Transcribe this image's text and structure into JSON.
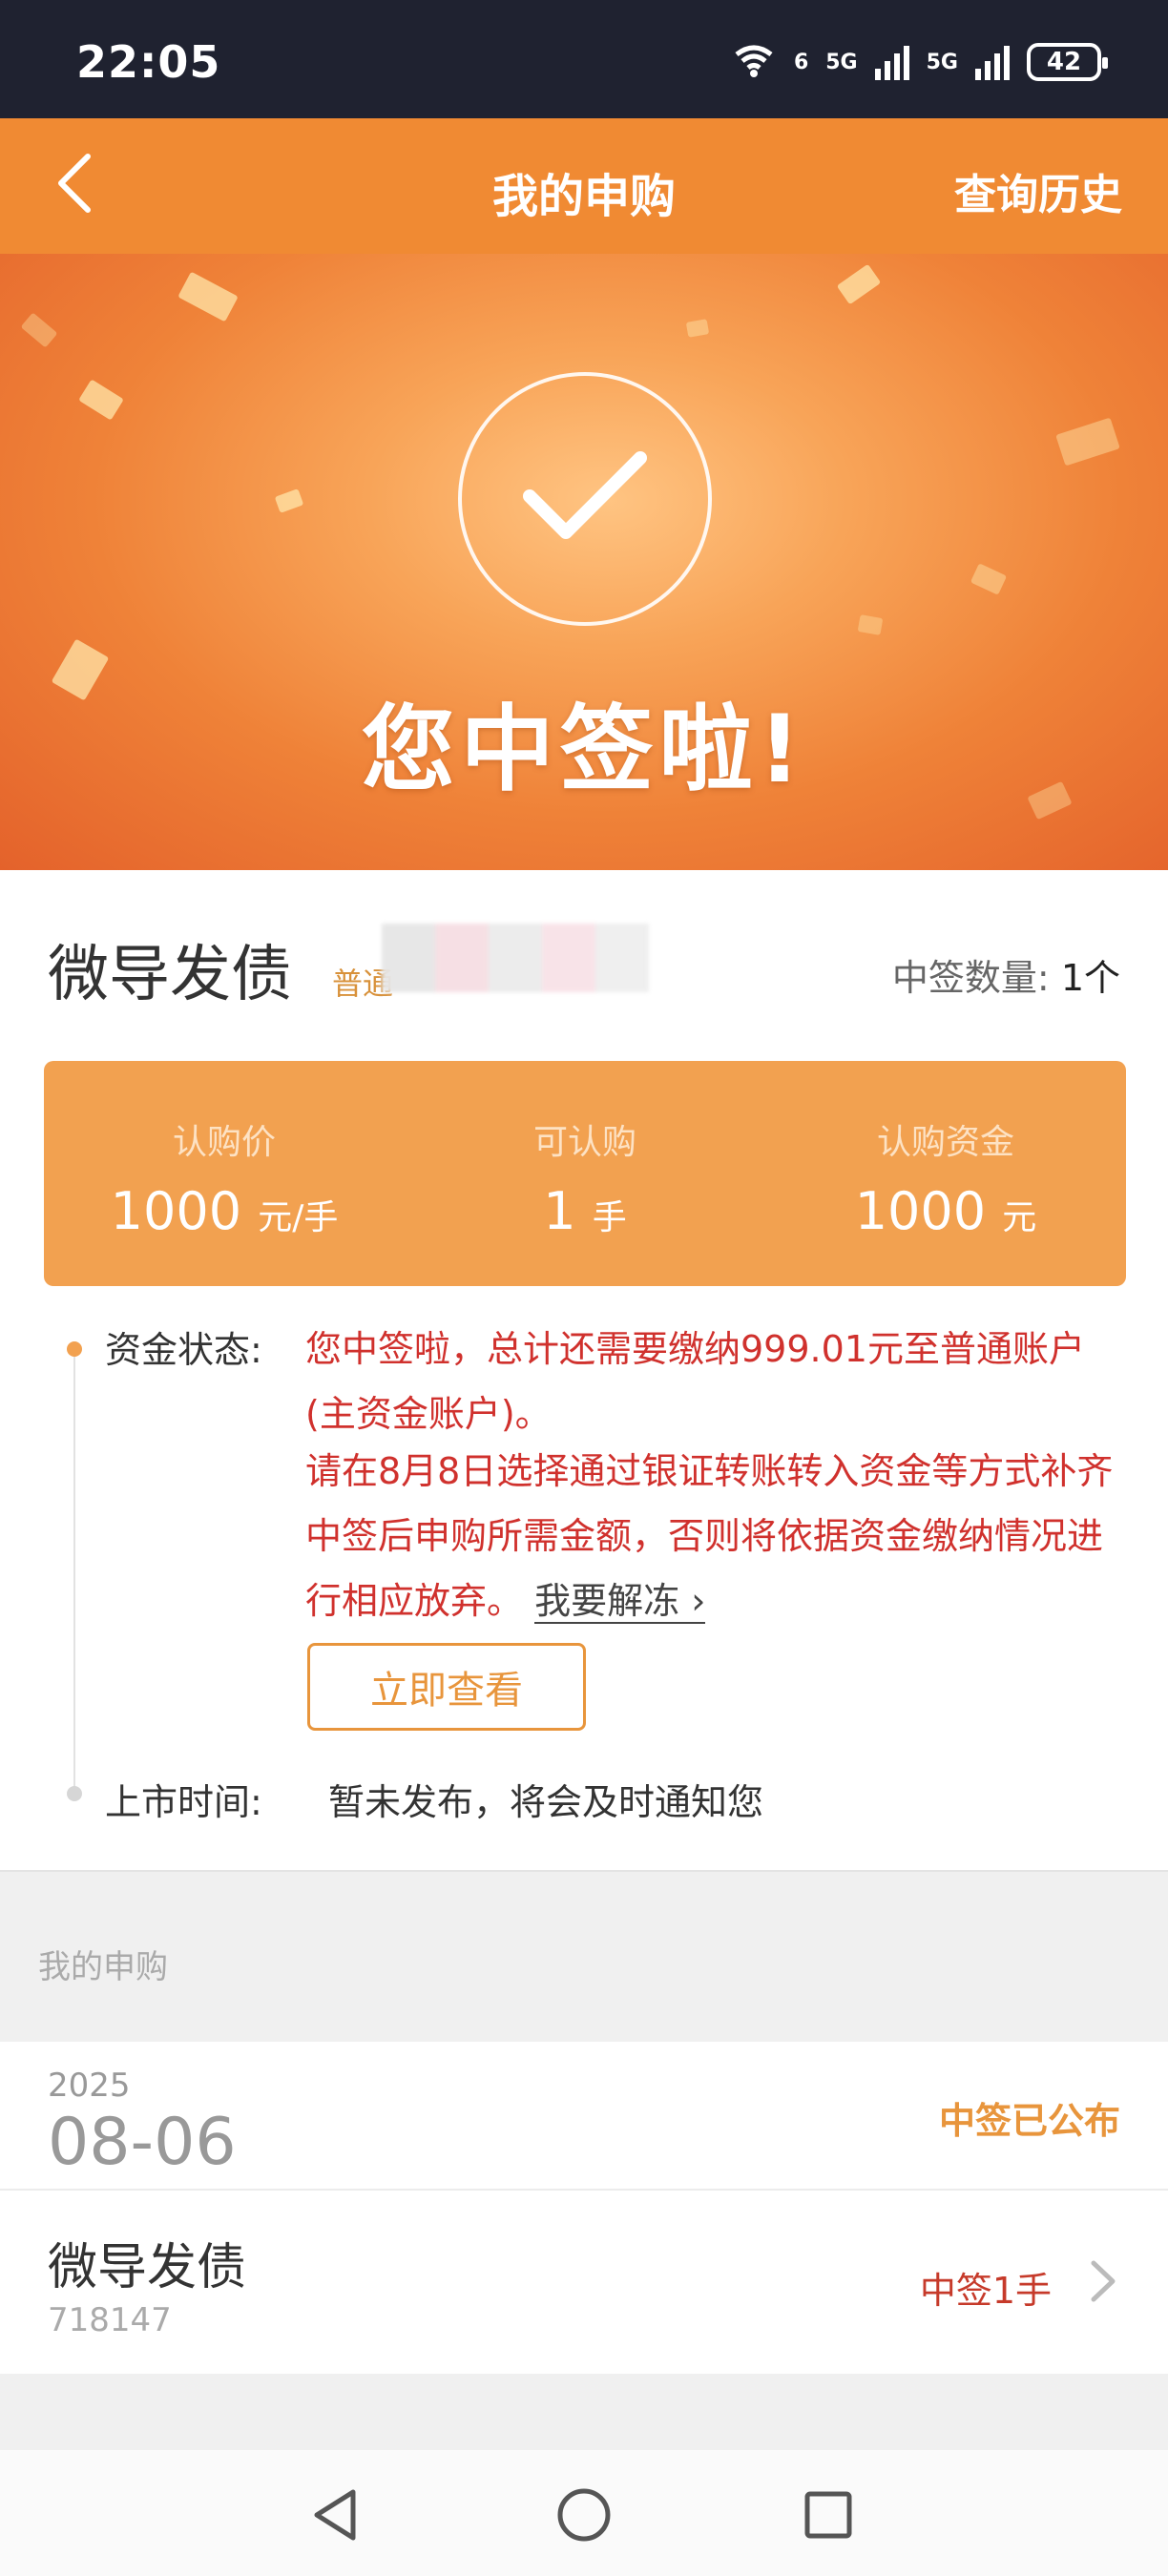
{
  "status_bar": {
    "time": "22:05",
    "wifi_label": "6",
    "sim1_label": "5G",
    "sim2_label": "5G",
    "battery": "42"
  },
  "navbar": {
    "back_icon": "chevron-left-icon",
    "title": "我的申购",
    "history": "查询历史"
  },
  "hero": {
    "icon": "check-icon",
    "title": "您中签啦!"
  },
  "summary": {
    "bond_name": "微导发债",
    "account_tag": "普通",
    "win_count_label": "中签数量:",
    "win_count_value": "1个"
  },
  "price_card": {
    "columns": [
      {
        "label": "认购价",
        "value": "1000",
        "unit": "元/手"
      },
      {
        "label": "可认购",
        "value": "1",
        "unit": "手"
      },
      {
        "label": "认购资金",
        "value": "1000",
        "unit": "元"
      }
    ]
  },
  "fund_status": {
    "label": "资金状态:",
    "text1": "您中签啦，总计还需要缴纳999.01元至普通账户(主资金账户)。",
    "text2": "请在8月8日选择通过银证转账转入资金等方式补齐中签后申购所需金额，否则将依据资金缴纳情况进行相应放弃。",
    "unfreeze_link": "我要解冻",
    "button": "立即查看"
  },
  "listing": {
    "label": "上市时间:",
    "value": "暂未发布，将会及时通知您"
  },
  "section": {
    "title": "我的申购"
  },
  "record": {
    "year": "2025",
    "month_day": "08-06",
    "status": "中签已公布",
    "bond_name": "微导发债",
    "bond_code": "718147",
    "result": "中签1手"
  },
  "colors": {
    "accent": "#f08a33",
    "card": "#f2a150",
    "alert_red": "#d0312d",
    "status_bar": "#1f2230"
  }
}
